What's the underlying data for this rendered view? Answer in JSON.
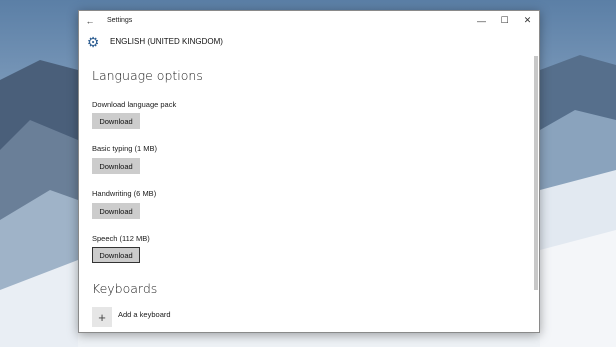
{
  "window": {
    "title": "Settings",
    "back_icon": "←",
    "minimize_icon": "—",
    "maximize_icon": "☐",
    "close_icon": "✕"
  },
  "header": {
    "icon": "gear-icon",
    "title": "ENGLISH (UNITED KINGDOM)"
  },
  "language_options": {
    "title": "Language options",
    "items": [
      {
        "label": "Download language pack",
        "button": "Download"
      },
      {
        "label": "Basic typing (1 MB)",
        "button": "Download"
      },
      {
        "label": "Handwriting (6 MB)",
        "button": "Download"
      },
      {
        "label": "Speech (112 MB)",
        "button": "Download"
      }
    ]
  },
  "keyboards": {
    "title": "Keyboards",
    "add_label": "Add a keyboard",
    "add_icon": "+"
  },
  "colors": {
    "accent": "#2d5d91",
    "button_bg": "#cccccc"
  }
}
